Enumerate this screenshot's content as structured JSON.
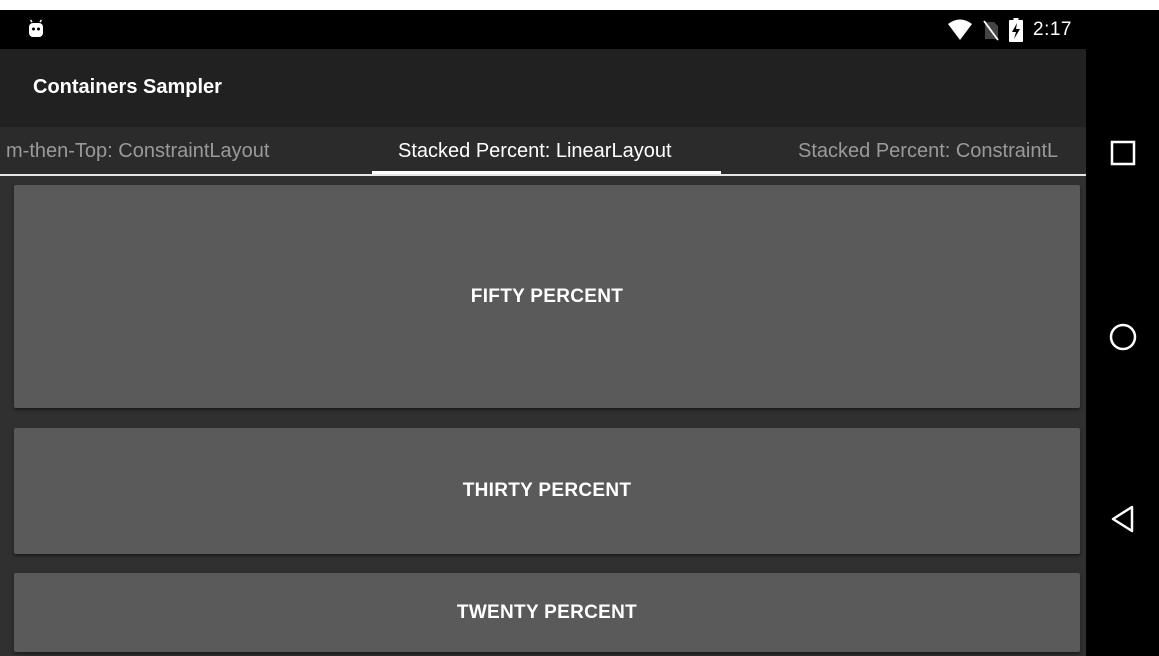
{
  "status_bar": {
    "time": "2:17",
    "icons": [
      "android-icon",
      "wifi-icon",
      "no-sim-icon",
      "battery-charging-icon"
    ]
  },
  "app_bar": {
    "title": "Containers Sampler"
  },
  "tabs": [
    {
      "label": "Bottom-then-Top: ConstraintLayout",
      "visible_label": "m-then-Top: ConstraintLayout",
      "selected": false
    },
    {
      "label": "Stacked Percent: LinearLayout",
      "visible_label": "Stacked Percent: LinearLayout",
      "selected": true
    },
    {
      "label": "Stacked Percent: ConstraintLayout",
      "visible_label": "Stacked Percent: ConstraintL",
      "selected": false
    }
  ],
  "buttons": {
    "fifty": "FIFTY PERCENT",
    "thirty": "THIRTY PERCENT",
    "twenty": "TWENTY PERCENT"
  },
  "nav_bar": {
    "icons": [
      "recent-apps-icon",
      "home-icon",
      "back-icon"
    ]
  },
  "colors": {
    "background": "#303030",
    "app_bar": "#212121",
    "button": "#5a5a5b",
    "indicator": "#ffffff"
  }
}
